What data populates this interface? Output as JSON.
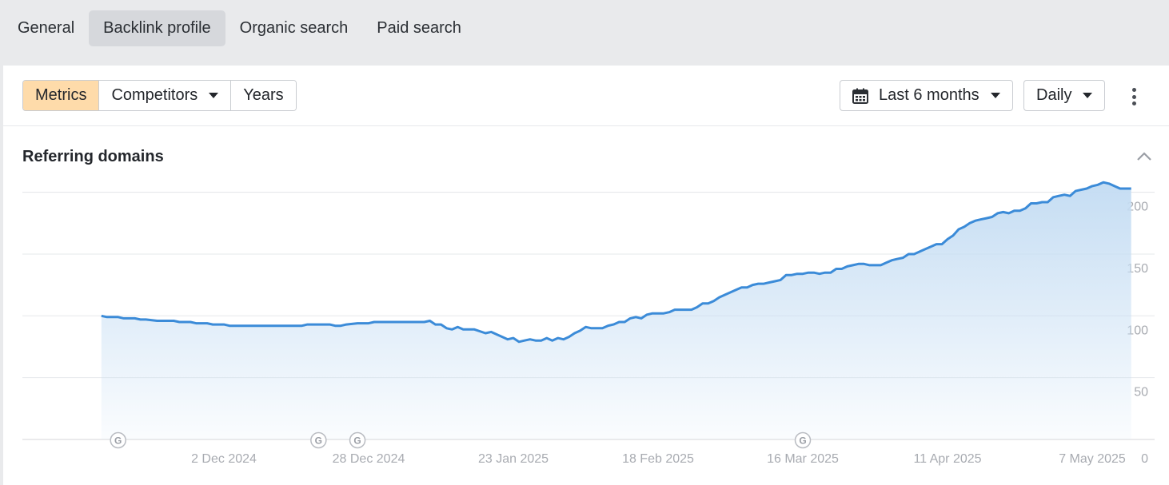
{
  "tabs": [
    {
      "label": "General",
      "active": false
    },
    {
      "label": "Backlink profile",
      "active": true
    },
    {
      "label": "Organic search",
      "active": false
    },
    {
      "label": "Paid search",
      "active": false
    }
  ],
  "toolbar": {
    "metrics_label": "Metrics",
    "competitors_label": "Competitors",
    "years_label": "Years",
    "period_label": "Last 6 months",
    "interval_label": "Daily",
    "calendar_icon": "calendar-icon",
    "more_icon": "more-vertical-icon"
  },
  "section": {
    "title": "Referring domains",
    "collapse_icon": "chevron-up-icon"
  },
  "colors": {
    "accent_active": "#fedbaa",
    "line": "#3b8bd8",
    "area": "#c5ddf3"
  },
  "chart_data": {
    "type": "area",
    "title": "Referring domains",
    "xlabel": "",
    "ylabel": "",
    "y_axis_side": "right",
    "ylim": [
      0,
      200
    ],
    "yticks": [
      0,
      50,
      100,
      150,
      200
    ],
    "xticks": [
      "2 Dec 2024",
      "28 Dec 2024",
      "23 Jan 2025",
      "18 Feb 2025",
      "16 Mar 2025",
      "11 Apr 2025",
      "7 May 2025"
    ],
    "xtick_dates": [
      "2024-12-02",
      "2024-12-28",
      "2025-01-23",
      "2025-02-18",
      "2025-03-16",
      "2025-04-11",
      "2025-05-07"
    ],
    "x_range": [
      "2024-11-06",
      "2025-05-15"
    ],
    "grid": true,
    "series": [
      {
        "points": [
          [
            "2024-11-10",
            100
          ],
          [
            "2024-11-11",
            99
          ],
          [
            "2024-11-13",
            99
          ],
          [
            "2024-11-14",
            98
          ],
          [
            "2024-11-16",
            98
          ],
          [
            "2024-11-17",
            97
          ],
          [
            "2024-11-18",
            97
          ],
          [
            "2024-11-20",
            96
          ],
          [
            "2024-11-21",
            96
          ],
          [
            "2024-11-23",
            96
          ],
          [
            "2024-11-24",
            95
          ],
          [
            "2024-11-26",
            95
          ],
          [
            "2024-11-27",
            94
          ],
          [
            "2024-11-29",
            94
          ],
          [
            "2024-11-30",
            93
          ],
          [
            "2024-12-01",
            93
          ],
          [
            "2024-12-02",
            93
          ],
          [
            "2024-12-03",
            92
          ],
          [
            "2024-12-08",
            92
          ],
          [
            "2024-12-12",
            92
          ],
          [
            "2024-12-14",
            92
          ],
          [
            "2024-12-16",
            92
          ],
          [
            "2024-12-17",
            93
          ],
          [
            "2024-12-21",
            93
          ],
          [
            "2024-12-22",
            92
          ],
          [
            "2024-12-23",
            92
          ],
          [
            "2024-12-24",
            93
          ],
          [
            "2024-12-26",
            94
          ],
          [
            "2024-12-28",
            94
          ],
          [
            "2024-12-29",
            95
          ],
          [
            "2025-01-05",
            95
          ],
          [
            "2025-01-07",
            95
          ],
          [
            "2025-01-08",
            96
          ],
          [
            "2025-01-09",
            93
          ],
          [
            "2025-01-10",
            93
          ],
          [
            "2025-01-11",
            90
          ],
          [
            "2025-01-12",
            89
          ],
          [
            "2025-01-13",
            91
          ],
          [
            "2025-01-14",
            89
          ],
          [
            "2025-01-16",
            89
          ],
          [
            "2025-01-18",
            86
          ],
          [
            "2025-01-19",
            87
          ],
          [
            "2025-01-20",
            85
          ],
          [
            "2025-01-21",
            83
          ],
          [
            "2025-01-22",
            81
          ],
          [
            "2025-01-23",
            82
          ],
          [
            "2025-01-24",
            79
          ],
          [
            "2025-01-25",
            80
          ],
          [
            "2025-01-26",
            81
          ],
          [
            "2025-01-27",
            80
          ],
          [
            "2025-01-28",
            80
          ],
          [
            "2025-01-29",
            82
          ],
          [
            "2025-01-30",
            80
          ],
          [
            "2025-01-31",
            82
          ],
          [
            "2025-02-01",
            81
          ],
          [
            "2025-02-02",
            83
          ],
          [
            "2025-02-03",
            86
          ],
          [
            "2025-02-04",
            88
          ],
          [
            "2025-02-05",
            91
          ],
          [
            "2025-02-06",
            90
          ],
          [
            "2025-02-07",
            90
          ],
          [
            "2025-02-08",
            90
          ],
          [
            "2025-02-09",
            92
          ],
          [
            "2025-02-10",
            93
          ],
          [
            "2025-02-11",
            95
          ],
          [
            "2025-02-12",
            95
          ],
          [
            "2025-02-13",
            98
          ],
          [
            "2025-02-14",
            99
          ],
          [
            "2025-02-15",
            98
          ],
          [
            "2025-02-16",
            101
          ],
          [
            "2025-02-17",
            102
          ],
          [
            "2025-02-18",
            102
          ],
          [
            "2025-02-19",
            102
          ],
          [
            "2025-02-20",
            103
          ],
          [
            "2025-02-21",
            105
          ],
          [
            "2025-02-23",
            105
          ],
          [
            "2025-02-24",
            105
          ],
          [
            "2025-02-25",
            107
          ],
          [
            "2025-02-26",
            110
          ],
          [
            "2025-02-27",
            110
          ],
          [
            "2025-02-28",
            112
          ],
          [
            "2025-03-01",
            115
          ],
          [
            "2025-03-02",
            117
          ],
          [
            "2025-03-03",
            119
          ],
          [
            "2025-03-04",
            121
          ],
          [
            "2025-03-05",
            123
          ],
          [
            "2025-03-06",
            123
          ],
          [
            "2025-03-07",
            125
          ],
          [
            "2025-03-08",
            126
          ],
          [
            "2025-03-09",
            126
          ],
          [
            "2025-03-10",
            127
          ],
          [
            "2025-03-11",
            128
          ],
          [
            "2025-03-12",
            129
          ],
          [
            "2025-03-13",
            133
          ],
          [
            "2025-03-14",
            133
          ],
          [
            "2025-03-15",
            134
          ],
          [
            "2025-03-16",
            134
          ],
          [
            "2025-03-17",
            135
          ],
          [
            "2025-03-18",
            135
          ],
          [
            "2025-03-19",
            134
          ],
          [
            "2025-03-20",
            135
          ],
          [
            "2025-03-21",
            135
          ],
          [
            "2025-03-22",
            138
          ],
          [
            "2025-03-23",
            138
          ],
          [
            "2025-03-24",
            140
          ],
          [
            "2025-03-25",
            141
          ],
          [
            "2025-03-26",
            142
          ],
          [
            "2025-03-27",
            142
          ],
          [
            "2025-03-28",
            141
          ],
          [
            "2025-03-30",
            141
          ],
          [
            "2025-03-31",
            143
          ],
          [
            "2025-04-01",
            145
          ],
          [
            "2025-04-02",
            146
          ],
          [
            "2025-04-03",
            147
          ],
          [
            "2025-04-04",
            150
          ],
          [
            "2025-04-05",
            150
          ],
          [
            "2025-04-06",
            152
          ],
          [
            "2025-04-07",
            154
          ],
          [
            "2025-04-08",
            156
          ],
          [
            "2025-04-09",
            158
          ],
          [
            "2025-04-10",
            158
          ],
          [
            "2025-04-11",
            162
          ],
          [
            "2025-04-12",
            165
          ],
          [
            "2025-04-13",
            170
          ],
          [
            "2025-04-14",
            172
          ],
          [
            "2025-04-15",
            175
          ],
          [
            "2025-04-16",
            177
          ],
          [
            "2025-04-17",
            178
          ],
          [
            "2025-04-18",
            179
          ],
          [
            "2025-04-19",
            180
          ],
          [
            "2025-04-20",
            183
          ],
          [
            "2025-04-21",
            184
          ],
          [
            "2025-04-22",
            183
          ],
          [
            "2025-04-23",
            185
          ],
          [
            "2025-04-24",
            185
          ],
          [
            "2025-04-25",
            187
          ],
          [
            "2025-04-26",
            191
          ],
          [
            "2025-04-27",
            191
          ],
          [
            "2025-04-28",
            192
          ],
          [
            "2025-04-29",
            192
          ],
          [
            "2025-04-30",
            196
          ],
          [
            "2025-05-01",
            197
          ],
          [
            "2025-05-02",
            198
          ],
          [
            "2025-05-03",
            197
          ],
          [
            "2025-05-04",
            201
          ],
          [
            "2025-05-05",
            202
          ],
          [
            "2025-05-06",
            203
          ],
          [
            "2025-05-07",
            205
          ],
          [
            "2025-05-08",
            206
          ],
          [
            "2025-05-09",
            208
          ],
          [
            "2025-05-10",
            207
          ],
          [
            "2025-05-11",
            205
          ],
          [
            "2025-05-12",
            203
          ],
          [
            "2025-05-13",
            203
          ],
          [
            "2025-05-14",
            203
          ]
        ]
      }
    ],
    "annotations": [
      {
        "date": "2024-11-13",
        "label": "G"
      },
      {
        "date": "2024-12-19",
        "label": "G"
      },
      {
        "date": "2024-12-26",
        "label": "G"
      },
      {
        "date": "2025-03-16",
        "label": "G"
      }
    ]
  }
}
